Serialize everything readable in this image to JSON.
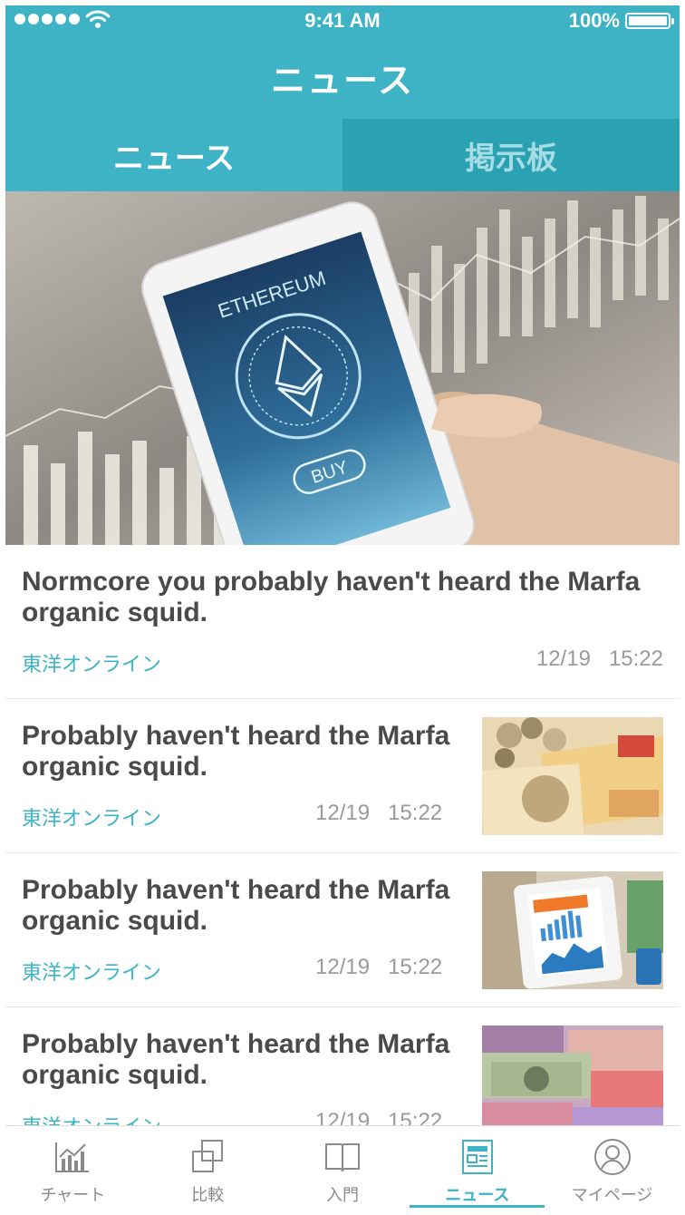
{
  "status_bar": {
    "time": "9:41 AM",
    "battery": "100%"
  },
  "header": {
    "title": "ニュース"
  },
  "tabs": [
    {
      "label": "ニュース",
      "active": true
    },
    {
      "label": "掲示板",
      "active": false
    }
  ],
  "hero": {
    "screen_text": "ETHEREUM",
    "button_text": "BUY"
  },
  "featured": {
    "title": "Normcore you probably haven't heard the Marfa organic squid.",
    "source": "東洋オンライン",
    "date": "12/19",
    "time": "15:22"
  },
  "articles": [
    {
      "title": "Probably haven't heard the Marfa organic squid.",
      "source": "東洋オンライン",
      "date": "12/19",
      "time": "15:22",
      "thumb": "currency-notes"
    },
    {
      "title": "Probably haven't heard the Marfa organic squid.",
      "source": "東洋オンライン",
      "date": "12/19",
      "time": "15:22",
      "thumb": "business-tablet"
    },
    {
      "title": "Probably haven't heard the Marfa organic squid.",
      "source": "東洋オンライン",
      "date": "12/19",
      "time": "15:22",
      "thumb": "world-banknotes"
    }
  ],
  "tab_bar": [
    {
      "label": "チャート",
      "icon": "chart-icon",
      "active": false
    },
    {
      "label": "比較",
      "icon": "compare-icon",
      "active": false
    },
    {
      "label": "入門",
      "icon": "book-icon",
      "active": false
    },
    {
      "label": "ニュース",
      "icon": "news-icon",
      "active": true
    },
    {
      "label": "マイページ",
      "icon": "user-icon",
      "active": false
    }
  ],
  "colors": {
    "accent": "#3db3c5",
    "tab_inactive_bg": "#2ba2b4",
    "text": "#4a4a4a",
    "muted": "#9a9a9a"
  }
}
